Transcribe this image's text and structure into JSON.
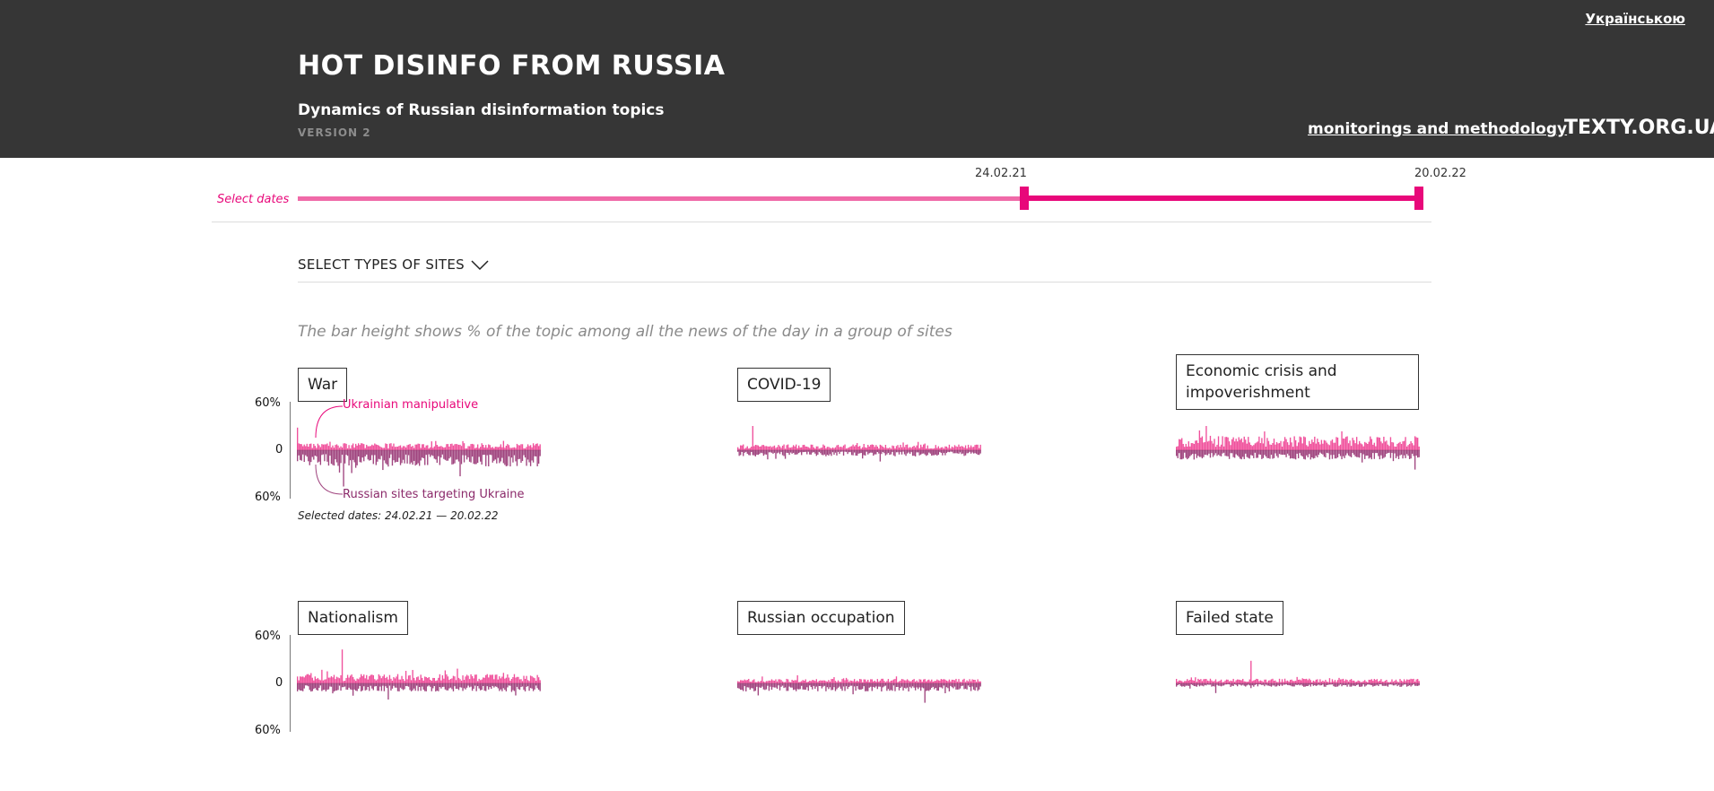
{
  "header": {
    "lang_link": "Українською",
    "title": "HOT DISINFO FROM RUSSIA",
    "subtitle": "Dynamics of Russian disinformation topics",
    "version": "VERSION 2",
    "methodology_link": "monitorings and methodology",
    "brand": "TEXTY.ORG.UA"
  },
  "date_range": {
    "label": "Select dates",
    "start": "24.02.21",
    "end": "20.02.22"
  },
  "site_types": {
    "label": "SELECT TYPES OF SITES",
    "icon": "chevron-down-icon"
  },
  "note": "The bar height shows % of the topic among all the news of the day in a group of sites",
  "selected_dates_text": "Selected dates: 24.02.21 — 20.02.22",
  "colors": {
    "accent": "#e8087a",
    "accent_light": "#f06aa8",
    "upper_series": "#f0519c",
    "lower_series": "#a0457f",
    "header_bg": "#363636"
  },
  "chart_data": [
    {
      "type": "bar",
      "title": "War",
      "y_top_label": "60%",
      "y_zero_label": "0",
      "y_bottom_label": "60%",
      "ylim": [
        -60,
        60
      ],
      "series": [
        {
          "name": "Ukrainian manipulative",
          "direction": "up",
          "typical": 6,
          "peak": 28
        },
        {
          "name": "Russian sites targeting Ukraine",
          "direction": "down",
          "typical": 14,
          "peak": 45
        }
      ]
    },
    {
      "type": "bar",
      "title": "COVID-19",
      "ylim": [
        -60,
        60
      ],
      "series": [
        {
          "name": "Ukrainian manipulative",
          "direction": "up",
          "typical": 5,
          "peak": 30
        },
        {
          "name": "Russian sites targeting Ukraine",
          "direction": "down",
          "typical": 5,
          "peak": 14
        }
      ]
    },
    {
      "type": "bar",
      "title": "Economic crisis and impoverishment",
      "ylim": [
        -60,
        60
      ],
      "series": [
        {
          "name": "Ukrainian manipulative",
          "direction": "up",
          "typical": 12,
          "peak": 30
        },
        {
          "name": "Russian sites targeting Ukraine",
          "direction": "down",
          "typical": 8,
          "peak": 24
        }
      ]
    },
    {
      "type": "bar",
      "title": "Nationalism",
      "y_top_label": "60%",
      "y_zero_label": "0",
      "y_bottom_label": "60%",
      "ylim": [
        -60,
        60
      ],
      "series": [
        {
          "name": "Ukrainian manipulative",
          "direction": "up",
          "typical": 8,
          "peak": 42
        },
        {
          "name": "Russian sites targeting Ukraine",
          "direction": "down",
          "typical": 7,
          "peak": 20
        }
      ]
    },
    {
      "type": "bar",
      "title": "Russian occupation",
      "ylim": [
        -60,
        60
      ],
      "series": [
        {
          "name": "Ukrainian manipulative",
          "direction": "up",
          "typical": 4,
          "peak": 10
        },
        {
          "name": "Russian sites targeting Ukraine",
          "direction": "down",
          "typical": 7,
          "peak": 24
        }
      ]
    },
    {
      "type": "bar",
      "title": "Failed state",
      "ylim": [
        -60,
        60
      ],
      "series": [
        {
          "name": "Ukrainian manipulative",
          "direction": "up",
          "typical": 4,
          "peak": 28
        },
        {
          "name": "Russian sites targeting Ukraine",
          "direction": "down",
          "typical": 3,
          "peak": 12
        }
      ]
    }
  ]
}
